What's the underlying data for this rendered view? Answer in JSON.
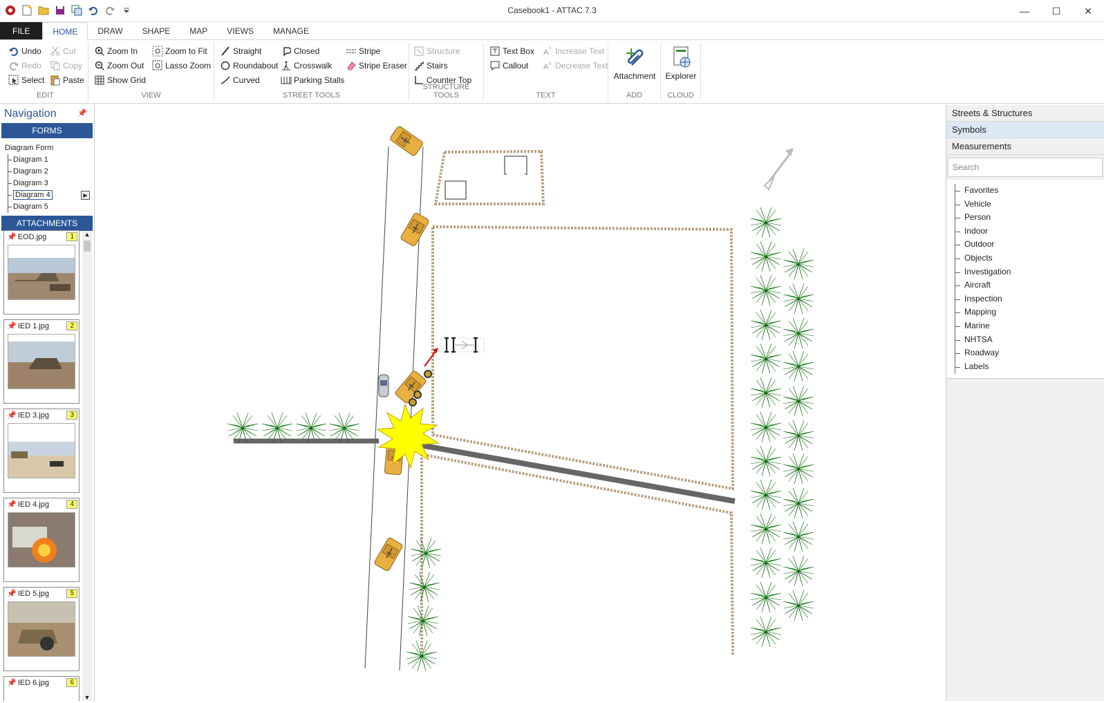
{
  "window": {
    "title": "Casebook1 - ATTAC 7.3",
    "min": "—",
    "max": "☐",
    "close": "✕"
  },
  "tabs": [
    "FILE",
    "HOME",
    "DRAW",
    "SHAPE",
    "MAP",
    "VIEWS",
    "MANAGE"
  ],
  "ribbon": {
    "edit": {
      "label": "EDIT",
      "undo": "Undo",
      "redo": "Redo",
      "select": "Select",
      "cut": "Cut",
      "copy": "Copy",
      "paste": "Paste"
    },
    "view": {
      "label": "VIEW",
      "zoom_in": "Zoom In",
      "zoom_out": "Zoom Out",
      "show_grid": "Show Grid",
      "zoom_fit": "Zoom to Fit",
      "lasso": "Lasso Zoom"
    },
    "street": {
      "label": "STREET TOOLS",
      "straight": "Straight",
      "roundabout": "Roundabout",
      "curved": "Curved",
      "closed": "Closed",
      "crosswalk": "Crosswalk",
      "parking": "Parking Stalls",
      "stripe": "Stripe",
      "stripe_eraser": "Stripe Eraser"
    },
    "structure": {
      "label": "STRUCTURE TOOLS",
      "structure": "Structure",
      "stairs": "Stairs",
      "counter": "Counter Top"
    },
    "text": {
      "label": "TEXT",
      "textbox": "Text Box",
      "callout": "Callout",
      "increase": "Increase Text",
      "decrease": "Decrease Text"
    },
    "add": {
      "label": "ADD",
      "attachment": "Attachment"
    },
    "cloud": {
      "label": "CLOUD",
      "explorer": "Explorer"
    }
  },
  "nav": {
    "title": "Navigation",
    "forms_label": "FORMS",
    "root": "Diagram Form",
    "diagrams": [
      "Diagram 1",
      "Diagram 2",
      "Diagram 3",
      "Diagram 4",
      "Diagram 5"
    ],
    "attachments_label": "ATTACHMENTS",
    "attachments": [
      {
        "name": "EOD.jpg",
        "n": "1"
      },
      {
        "name": "IED 1.jpg",
        "n": "2"
      },
      {
        "name": "IED 3.jpg",
        "n": "3"
      },
      {
        "name": "IED 4.jpg",
        "n": "4"
      },
      {
        "name": "IED 5.jpg",
        "n": "5"
      },
      {
        "name": "IED 6.jpg",
        "n": "6"
      }
    ]
  },
  "right": {
    "sections": [
      "Streets & Structures",
      "Symbols",
      "Measurements"
    ],
    "search_placeholder": "Search",
    "categories": [
      "Favorites",
      "Vehicle",
      "Person",
      "Indoor",
      "Outdoor",
      "Objects",
      "Investigation",
      "Aircraft",
      "Inspection",
      "Mapping",
      "Marine",
      "NHTSA",
      "Roadway",
      "Labels"
    ]
  },
  "colors": {
    "accent": "#2b5797",
    "palm": "#1a9a1a",
    "vehicle": "#e8b040",
    "explosion": "#ffff00"
  }
}
